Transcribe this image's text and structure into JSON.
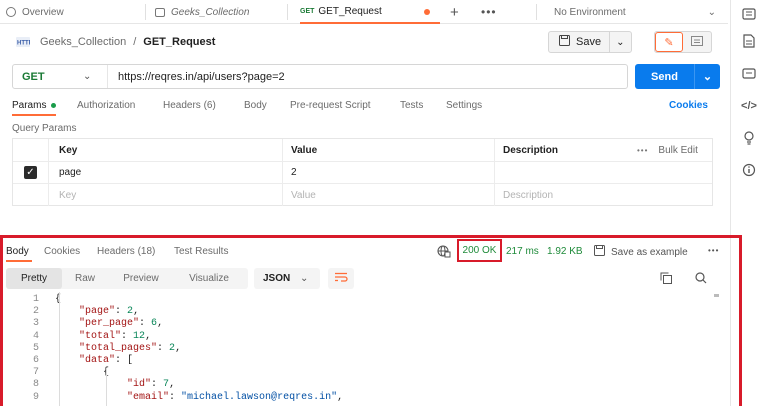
{
  "tabs": {
    "overview": "Overview",
    "collection": "Geeks_Collection",
    "request_method": "GET",
    "request_name": "GET_Request",
    "environment": "No Environment"
  },
  "breadcrumb": {
    "collection": "Geeks_Collection",
    "separator": "/",
    "request": "GET_Request",
    "save_label": "Save"
  },
  "url_bar": {
    "method": "GET",
    "url": "https://reqres.in/api/users?page=2",
    "send_label": "Send"
  },
  "request_tabs": {
    "params": "Params",
    "authorization": "Authorization",
    "headers": "Headers (6)",
    "body": "Body",
    "pre_request": "Pre-request Script",
    "tests": "Tests",
    "settings": "Settings",
    "cookies": "Cookies"
  },
  "query_params": {
    "title": "Query Params",
    "col_key": "Key",
    "col_value": "Value",
    "col_description": "Description",
    "bulk_edit": "Bulk Edit",
    "rows": [
      {
        "checked": true,
        "key": "page",
        "value": "2",
        "description": ""
      }
    ],
    "placeholder_key": "Key",
    "placeholder_value": "Value",
    "placeholder_description": "Description"
  },
  "response": {
    "tabs": {
      "body": "Body",
      "cookies": "Cookies",
      "headers": "Headers (18)",
      "test_results": "Test Results"
    },
    "status": "200 OK",
    "time": "217 ms",
    "size": "1.92 KB",
    "save_example": "Save as example",
    "view_tabs": {
      "pretty": "Pretty",
      "raw": "Raw",
      "preview": "Preview",
      "visualize": "Visualize",
      "format": "JSON"
    },
    "lines": [
      {
        "n": "1",
        "t": "{"
      },
      {
        "n": "2",
        "t": "    \"page\": 2,"
      },
      {
        "n": "3",
        "t": "    \"per_page\": 6,"
      },
      {
        "n": "4",
        "t": "    \"total\": 12,"
      },
      {
        "n": "5",
        "t": "    \"total_pages\": 2,"
      },
      {
        "n": "6",
        "t": "    \"data\": ["
      },
      {
        "n": "7",
        "t": "        {"
      },
      {
        "n": "8",
        "t": "            \"id\": 7,"
      },
      {
        "n": "9",
        "t": "            \"email\": \"michael.lawson@reqres.in\","
      }
    ]
  },
  "colors": {
    "accent": "#ff6c37",
    "send": "#097bed",
    "status_ok": "#1f8b3a",
    "highlight": "#d81b2a"
  }
}
